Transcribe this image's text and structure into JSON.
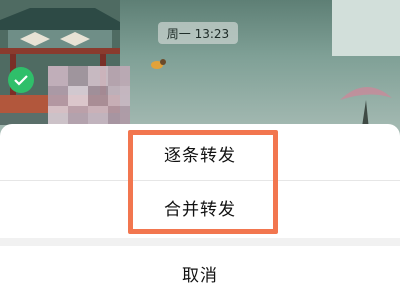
{
  "chat": {
    "timestamp": "周一 13:23"
  },
  "action_sheet": {
    "options": [
      {
        "label": "逐条转发"
      },
      {
        "label": "合并转发"
      }
    ],
    "cancel_label": "取消"
  },
  "colors": {
    "highlight": "#f2764f",
    "check": "#2fbf6a"
  }
}
